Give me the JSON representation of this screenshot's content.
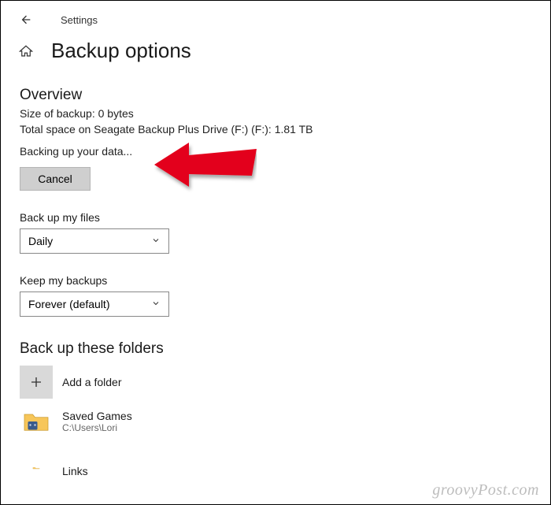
{
  "header": {
    "app_title": "Settings",
    "page_title": "Backup options"
  },
  "overview": {
    "heading": "Overview",
    "size_line": "Size of backup: 0 bytes",
    "space_line": "Total space on Seagate Backup Plus Drive (F:) (F:): 1.81 TB",
    "status_line": "Backing up your data...",
    "cancel_label": "Cancel"
  },
  "frequency": {
    "label": "Back up my files",
    "value": "Daily"
  },
  "retention": {
    "label": "Keep my backups",
    "value": "Forever (default)"
  },
  "folders": {
    "heading": "Back up these folders",
    "add_label": "Add a folder",
    "items": [
      {
        "name": "Saved Games",
        "path": "C:\\Users\\Lori"
      },
      {
        "name": "Links",
        "path": ""
      }
    ]
  },
  "watermark": "groovyPost.com"
}
